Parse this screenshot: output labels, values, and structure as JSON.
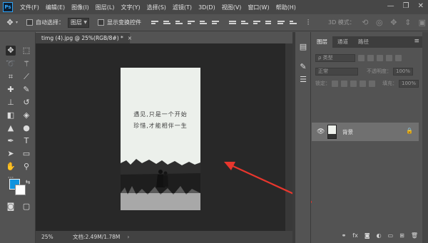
{
  "app": {
    "logo": "Ps"
  },
  "menu": [
    "文件(F)",
    "编辑(E)",
    "图像(I)",
    "图层(L)",
    "文字(Y)",
    "选择(S)",
    "滤镜(T)",
    "3D(D)",
    "视图(V)",
    "窗口(W)",
    "帮助(H)"
  ],
  "window_controls": {
    "minimize": "—",
    "restore": "❐",
    "close": "✕"
  },
  "options": {
    "auto_select_label": "自动选择：",
    "auto_select_value": "图层",
    "show_transform_label": "显示变换控件",
    "mode_3d": "3D 模式："
  },
  "document": {
    "tab_title": "timg (4).jpg @ 25%(RGB/8#) *",
    "close": "×",
    "text_line1": "遇见,只是一个开始",
    "text_line2": "珍惜,才能相伴一生"
  },
  "status": {
    "zoom": "25%",
    "doc_info": "文档:2.49M/1.78M",
    "arrow": "›"
  },
  "layers_panel": {
    "tabs": [
      "图层",
      "通道",
      "路径"
    ],
    "filter_placeholder": "ρ 类型",
    "blend_mode": "正常",
    "opacity_label": "不透明度：",
    "opacity_value": "100%",
    "lock_label": "锁定：",
    "fill_label": "填充：",
    "fill_value": "100%",
    "layer_name": "背景"
  },
  "colors": {
    "foreground": "#0f93df",
    "background": "#ffffff",
    "annotation_arrow": "#e8362d"
  }
}
